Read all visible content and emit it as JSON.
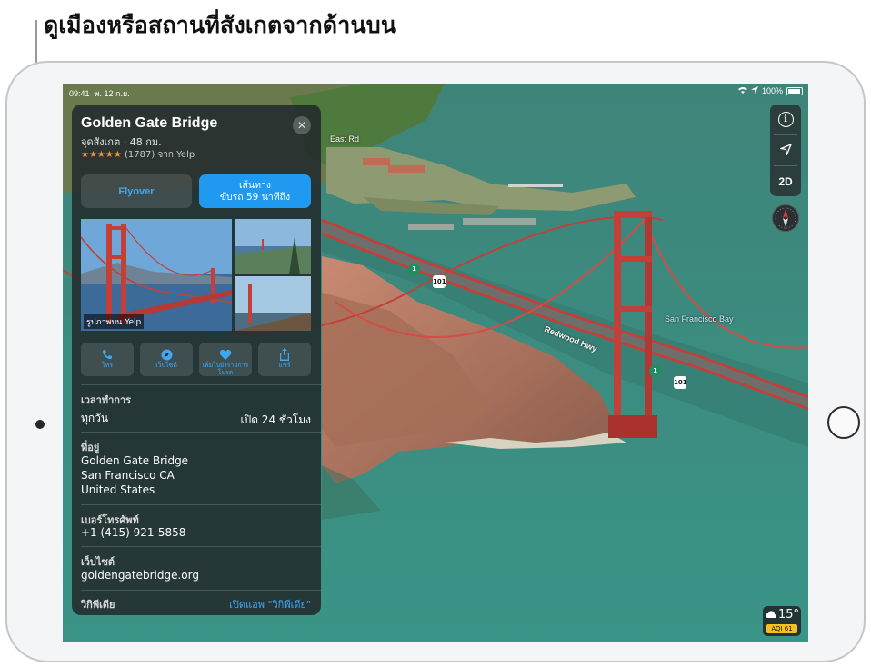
{
  "callout": {
    "text": "ดูเมืองหรือสถานที่สังเกตจากด้านบน"
  },
  "status": {
    "time": "09:41",
    "date": "พ. 12 ก.ย.",
    "battery": "100%"
  },
  "place": {
    "title": "Golden Gate Bridge",
    "subtitle": "จุดสังเกต · 48 กม.",
    "stars": "★★★★★",
    "rating_text": "(1787) จาก  Yelp",
    "close": "✕"
  },
  "buttons": {
    "flyover": "Flyover",
    "directions_line1": "เส้นทาง",
    "directions_line2": "ขับรถ 59 นาทีถึง"
  },
  "photos": {
    "caption": "รูปภาพบน Yelp"
  },
  "actions": [
    {
      "label": "โทร",
      "icon": "phone-icon"
    },
    {
      "label": "เว็บไซต์",
      "icon": "compass-icon"
    },
    {
      "label": "เพิ่มไปยังรายการโปรด",
      "icon": "heart-icon"
    },
    {
      "label": "แชร์",
      "icon": "share-icon"
    }
  ],
  "info": {
    "hours_label": "เวลาทำการ",
    "hours_days": "ทุกวัน",
    "hours_value": "เปิด 24 ชั่วโมง",
    "address_label": "ที่อยู่",
    "address_line1": "Golden Gate Bridge",
    "address_line2": "San Francisco CA",
    "address_line3": "United States",
    "phone_label": "เบอร์โทรศัพท์",
    "phone_value": "+1 (415) 921-5858",
    "website_label": "เว็บไซต์",
    "website_value": "goldengatebridge.org",
    "wiki_label": "วิกิพีเดีย",
    "wiki_link": "เปิดแอพ \"วิกิพีเดีย\""
  },
  "map": {
    "label_east_rd": "East Rd",
    "label_redwood": "Redwood Hwy",
    "label_bay": "San Francisco Bay",
    "shield_101_a": "101",
    "shield_101_b": "101",
    "shield_1_a": "1",
    "shield_1_b": "1"
  },
  "controls": {
    "info": "i",
    "mode": "2D"
  },
  "weather": {
    "temp": "15°",
    "aqi": "AQI 61"
  },
  "colors": {
    "accent": "#1f9af0",
    "bridge": "#c3403a",
    "water": "#3f8c84",
    "cliff": "#b07a63"
  }
}
